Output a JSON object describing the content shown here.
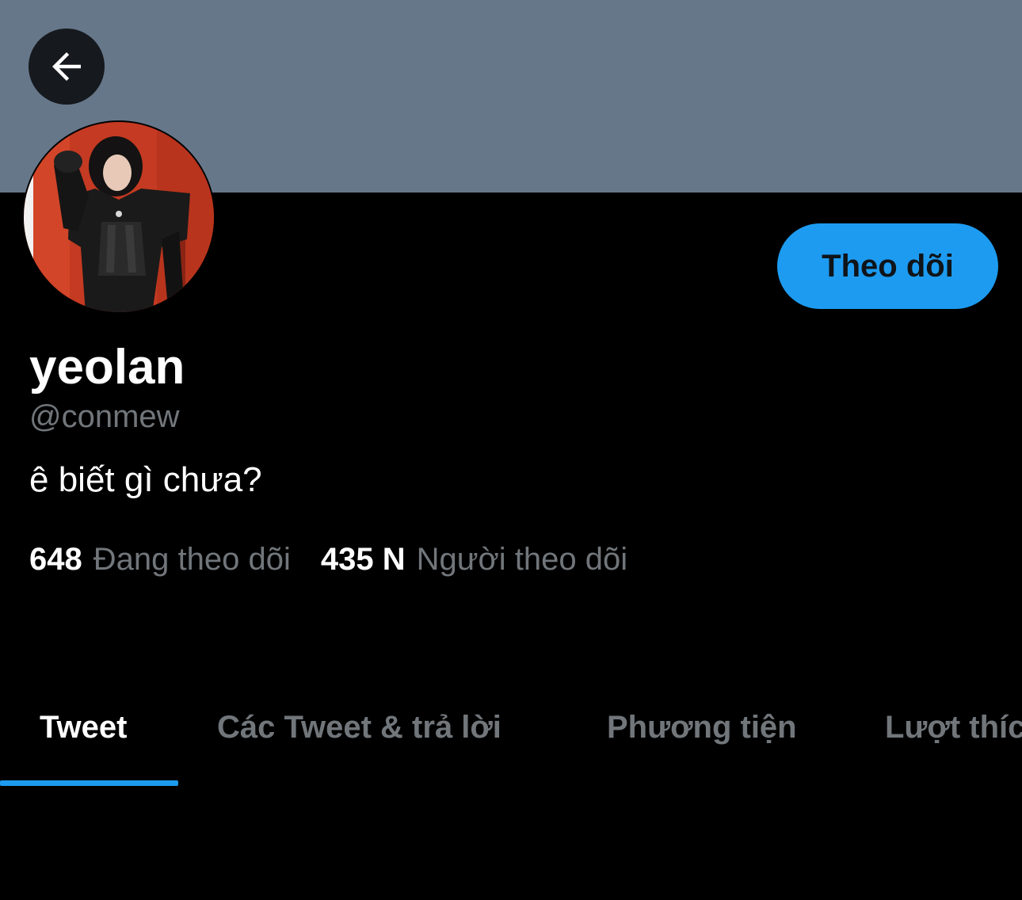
{
  "profile": {
    "display_name": "yeolan",
    "handle": "@conmew",
    "bio": "ê biết gì chưa?",
    "follow_label": "Theo dõi"
  },
  "stats": {
    "following_count": "648",
    "following_label": "Đang theo dõi",
    "followers_count": "435 N",
    "followers_label": "Người theo dõi"
  },
  "tabs": [
    {
      "label": "Tweet",
      "active": true
    },
    {
      "label": "Các Tweet & trả lời",
      "active": false
    },
    {
      "label": "Phương tiện",
      "active": false
    },
    {
      "label": "Lượt thích",
      "active": false
    }
  ],
  "colors": {
    "banner": "#66778a",
    "accent": "#1d9bf0",
    "background": "#000000",
    "secondary_text": "#71767b"
  },
  "icons": {
    "back": "arrow-left-icon"
  }
}
